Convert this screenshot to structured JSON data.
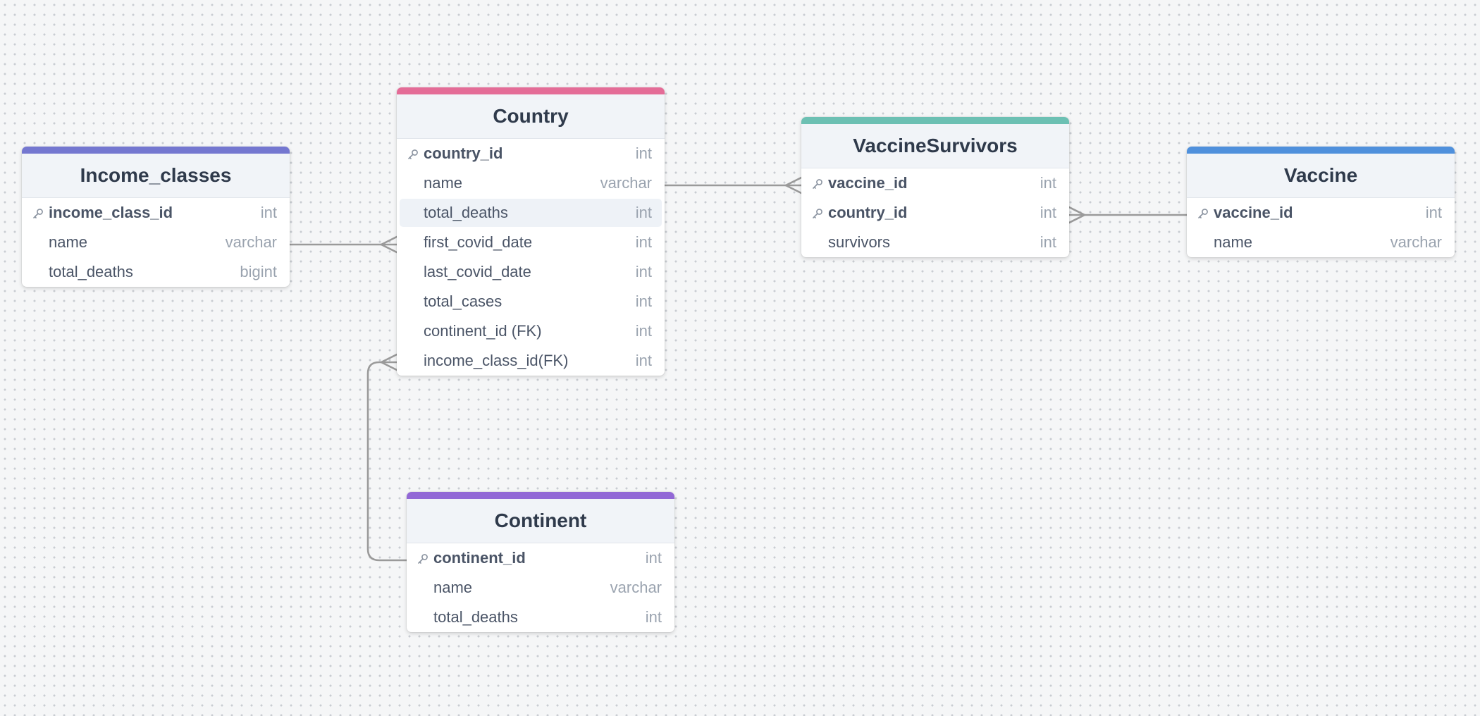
{
  "tables": {
    "income_classes": {
      "name": "Income_classes",
      "accent": "#7477d0",
      "columns": [
        {
          "name": "income_class_id",
          "type": "int",
          "pk": true
        },
        {
          "name": "name",
          "type": "varchar",
          "pk": false
        },
        {
          "name": "total_deaths",
          "type": "bigint",
          "pk": false
        }
      ]
    },
    "country": {
      "name": "Country",
      "accent": "#e46c97",
      "columns": [
        {
          "name": "country_id",
          "type": "int",
          "pk": true
        },
        {
          "name": "name",
          "type": "varchar",
          "pk": false
        },
        {
          "name": "total_deaths",
          "type": "int",
          "pk": false
        },
        {
          "name": "first_covid_date",
          "type": "int",
          "pk": false
        },
        {
          "name": "last_covid_date",
          "type": "int",
          "pk": false
        },
        {
          "name": "total_cases",
          "type": "int",
          "pk": false
        },
        {
          "name": "continent_id (FK)",
          "type": "int",
          "pk": false
        },
        {
          "name": "income_class_id(FK)",
          "type": "int",
          "pk": false
        }
      ]
    },
    "vaccine_survivors": {
      "name": "VaccineSurvivors",
      "accent": "#6cc0b3",
      "columns": [
        {
          "name": "vaccine_id",
          "type": "int",
          "pk": true
        },
        {
          "name": "country_id",
          "type": "int",
          "pk": true
        },
        {
          "name": "survivors",
          "type": "int",
          "pk": false
        }
      ]
    },
    "vaccine": {
      "name": "Vaccine",
      "accent": "#4f90dc",
      "columns": [
        {
          "name": "vaccine_id",
          "type": "int",
          "pk": true
        },
        {
          "name": "name",
          "type": "varchar",
          "pk": false
        }
      ]
    },
    "continent": {
      "name": "Continent",
      "accent": "#9268d6",
      "columns": [
        {
          "name": "continent_id",
          "type": "int",
          "pk": true
        },
        {
          "name": "name",
          "type": "varchar",
          "pk": false
        },
        {
          "name": "total_deaths",
          "type": "int",
          "pk": false
        }
      ]
    }
  },
  "relationships": [
    {
      "from": "income_classes.name",
      "to": "country.first_covid_date",
      "end": "many"
    },
    {
      "from": "country.name",
      "to": "vaccine_survivors.vaccine_id",
      "end": "many"
    },
    {
      "from": "vaccine.vaccine_id",
      "to": "vaccine_survivors.country_id",
      "end": "many"
    },
    {
      "from": "continent.continent_id",
      "to": "country.income_class_id(FK)",
      "end": "many"
    }
  ],
  "highlighted_row": "country.total_deaths",
  "icons": {
    "primary_key": "key-icon"
  }
}
